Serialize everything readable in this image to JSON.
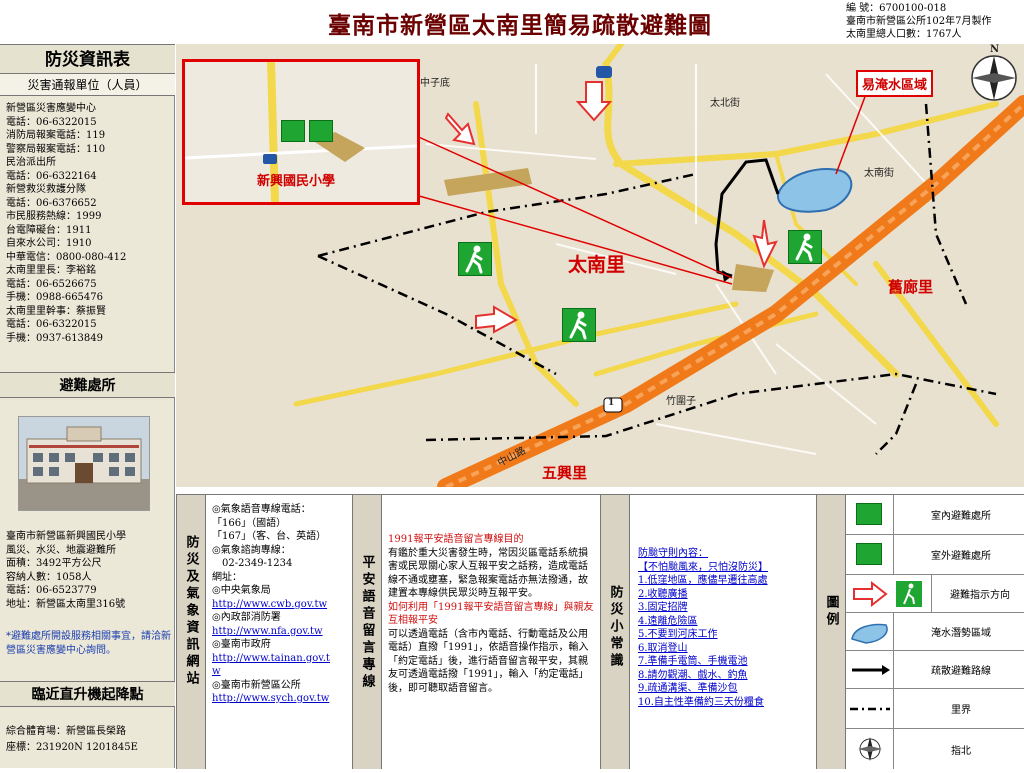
{
  "title": "臺南市新營區太南里簡易疏散避難圖",
  "meta": [
    "編 號：6700100-018",
    "臺南市新營區公所102年7月製作",
    "太南里總人口數：1767人"
  ],
  "left": {
    "panel_title": "防災資訊表",
    "contact_header": "災害通報單位（人員）",
    "contacts": [
      "新營區災害應變中心",
      "電話：06-6322015",
      "消防局報案電話：119",
      "警察局報案電話：110",
      "民治派出所",
      "電話：06-6322164",
      "新營救災救護分隊",
      "電話：06-6376652",
      "市民服務熱線：1999",
      "台電障礙台：1911",
      "自來水公司：1910",
      "中華電信：0800-080-412",
      "太南里里長：李裕銘",
      "電話：06-6526675",
      "手機：0988-665476",
      "太南里里幹事：蔡振賢",
      "電話：06-6322015",
      "手機：0937-613849"
    ],
    "shelter_header": "避難處所",
    "shelter_info": [
      "臺南市新營區新興國民小學",
      "風災、水災、地震避難所",
      "面積：3492平方公尺",
      "容納人數：1058人",
      "電話：06-6523779",
      "地址：新營區太南里316號"
    ],
    "shelter_note": "*避難處所開設服務相關事宜，請洽新營區災害應變中心詢問。",
    "heli_header": "臨近直升機起降點",
    "heli_info": [
      "綜合體育場：新營區長榮路",
      "座標：231920N 1201845E"
    ]
  },
  "map": {
    "inset_label": "新興國民小學",
    "flood_label": "易淹水區域",
    "village": "太南里",
    "neighbor_east": "舊廊里",
    "neighbor_south": "五興里",
    "road_labels": [
      "中子底",
      "太北街",
      "太南街",
      "竹圍子",
      "中山路"
    ],
    "route_badge": "1",
    "north_label": "N",
    "colors": {
      "road": "#f2d84a",
      "highway": "#f07a1a",
      "flood": "#8ec3e8",
      "border": "#000000",
      "route": "#000000",
      "sign": "#1fa531"
    }
  },
  "bottom": {
    "col1_title": "防災及氣象資訊網站",
    "col1_lines": [
      {
        "t": "◎氣象語音專線電話："
      },
      {
        "t": "「166」（國語）"
      },
      {
        "t": "「167」（客、台、英語）"
      },
      {
        "t": "◎氣象諮詢專線："
      },
      {
        "t": "　02-2349-1234"
      },
      {
        "t": "網址："
      },
      {
        "t": "◎中央氣象局"
      },
      {
        "t": "http://www.cwb.gov.tw",
        "link": true
      },
      {
        "t": "◎內政部消防署"
      },
      {
        "t": "http://www.nfa.gov.tw",
        "link": true
      },
      {
        "t": "◎臺南市政府"
      },
      {
        "t": "http://www.tainan.gov.t",
        "link": true
      },
      {
        "t": "w",
        "link": true
      },
      {
        "t": "◎臺南市新營區公所"
      },
      {
        "t": "http://www.sych.gov.tw",
        "link": true
      }
    ],
    "col2_title": "平安語音留言專線",
    "col2_heading": "1991報平安語音留言專線目的",
    "col2_p1": "有鑑於重大災害發生時，常因災區電話系統損害或民眾關心家人互報平安之話務，造成電話線不通或壅塞，緊急報案電話亦無法撥通，故建置本專線供民眾災時互報平安。",
    "col2_q": "如何利用「1991報平安語音留言專線」與親友互相報平安",
    "col2_p2": "可以透過電話（含市內電話、行動電話及公用電話）直撥「1991」，依語音操作指示，輸入「約定電話」後，進行語音留言報平安，其親友可透過電話撥「1991」，輸入「約定電話」後，即可聽取語音留言。",
    "col3_title": "防災小常識",
    "col3_lines": [
      "防颱守則內容：",
      "【不怕颱風來，只怕沒防災】",
      "1.低窪地區，應儘早遷往高處",
      "2.收聽廣播",
      "3.固定招牌",
      "4.遠離危險區",
      "5.不要到河床工作",
      "6.取消登山",
      "7.準備手電筒、手機電池",
      "8.請勿觀潮、戲水、釣魚",
      "9.疏通溝渠、準備沙包",
      "10.自主性準備約三天份糧食"
    ],
    "legend_title": "圖例",
    "legend": [
      "室內避難處所",
      "室外避難處所",
      "避難指示方向",
      "淹水潛勢區域",
      "疏散避難路線",
      "里界",
      "指北"
    ]
  }
}
